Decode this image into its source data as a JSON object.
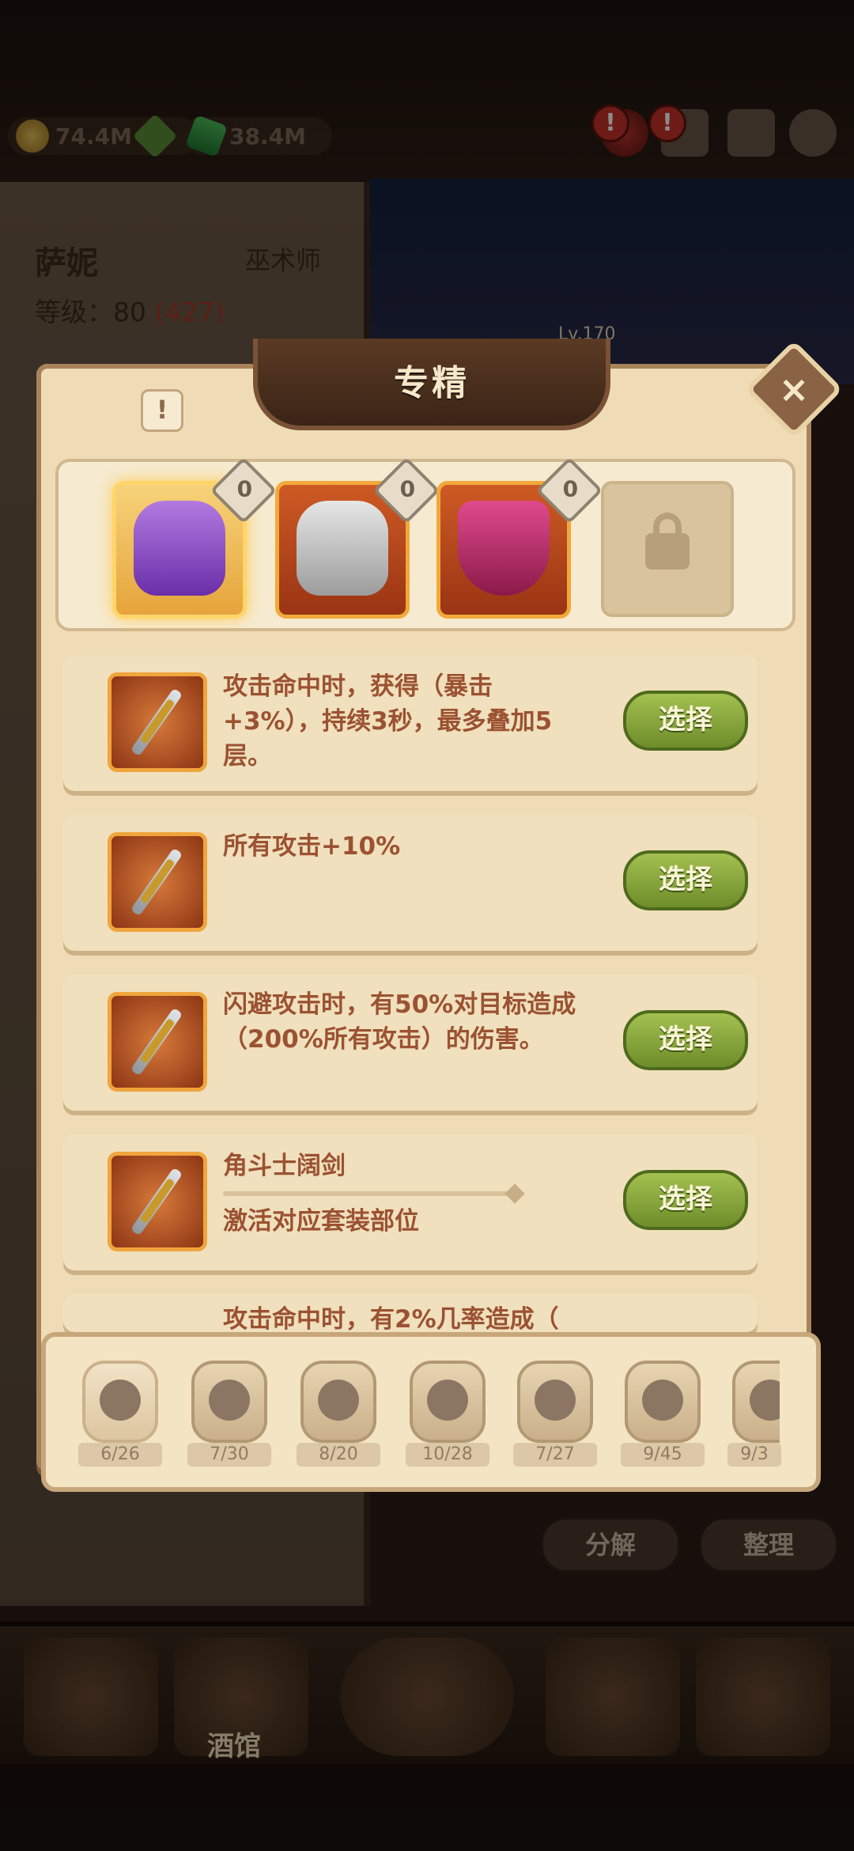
{
  "currency": {
    "gold": "74.4M",
    "gems": "38.4M"
  },
  "hero": {
    "name": "萨妮",
    "class": "巫术师",
    "level_label": "等级：",
    "level": "80",
    "level_bonus": "(427)",
    "stage_level": "Lv.170"
  },
  "alerts": [
    "!",
    "!"
  ],
  "modal": {
    "title": "专精",
    "close": "×",
    "info": "!",
    "slot_badge": "0",
    "cards": [
      {
        "text": "攻击命中时，获得（暴击+3%），持续3秒，最多叠加5层。",
        "button": "选择"
      },
      {
        "text": "所有攻击+10%",
        "button": "选择"
      },
      {
        "text": "闪避攻击时，有50%对目标造成（200%所有攻击）的伤害。",
        "button": "选择"
      },
      {
        "text": "角斗士阔剑",
        "sub": "激活对应套装部位",
        "button": "选择"
      },
      {
        "text": "攻击命中时，有2%几率造成（"
      }
    ]
  },
  "filters": [
    {
      "icon": "boot-icon",
      "count": "6/26"
    },
    {
      "icon": "meat-icon",
      "count": "7/30"
    },
    {
      "icon": "dagger-icon",
      "count": "8/20"
    },
    {
      "icon": "shield-icon",
      "count": "10/28"
    },
    {
      "icon": "book-icon",
      "count": "7/27"
    },
    {
      "icon": "bear-icon",
      "count": "9/45"
    },
    {
      "icon": "staff-icon",
      "count": "9/3"
    }
  ],
  "actions": {
    "decompose": "分解",
    "organize": "整理"
  },
  "nav": {
    "tavern": "酒馆"
  },
  "colors": {
    "accent_orange": "#f0a53c",
    "select_green": "#8aab3a",
    "text_brown": "#9b5232"
  }
}
